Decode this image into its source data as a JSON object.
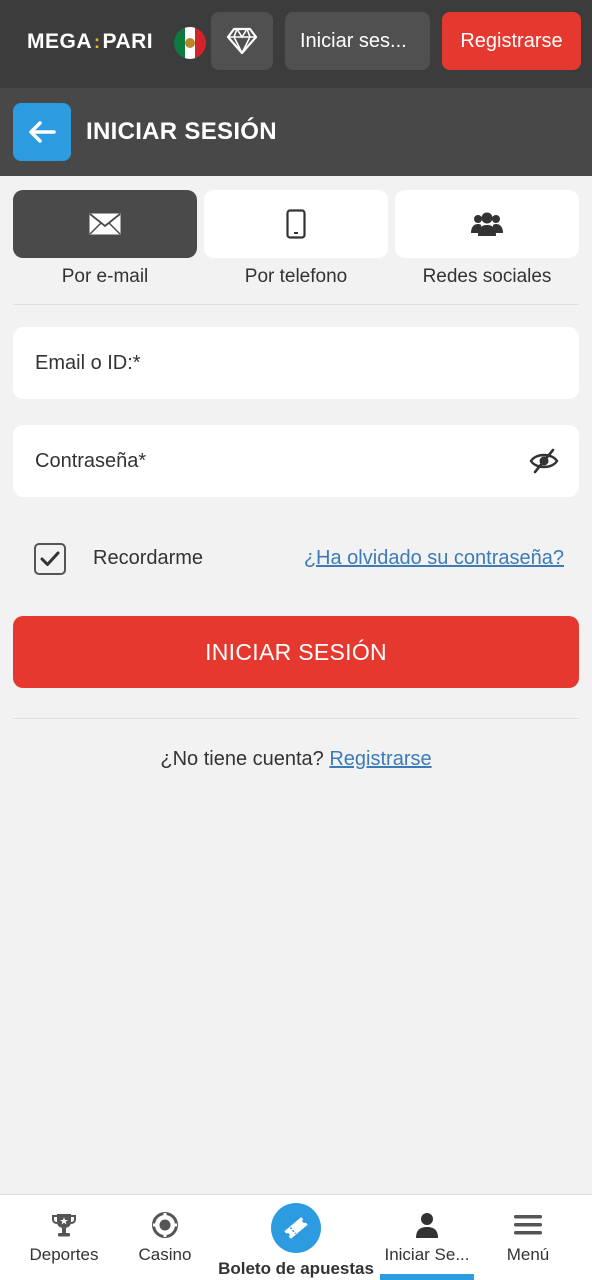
{
  "topbar": {
    "logo_left": "MEGA",
    "logo_sep": ":",
    "logo_right": "PARI",
    "login_label": "Iniciar ses...",
    "register_label": "Registrarse"
  },
  "header": {
    "title": "INICIAR SESIÓN"
  },
  "tabs": [
    {
      "label": "Por e-mail",
      "icon": "envelope-icon",
      "active": true
    },
    {
      "label": "Por telefono",
      "icon": "phone-icon",
      "active": false
    },
    {
      "label": "Redes sociales",
      "icon": "users-icon",
      "active": false
    }
  ],
  "form": {
    "email_placeholder": "Email o ID:*",
    "password_placeholder": "Contraseña*",
    "remember_label": "Recordarme",
    "remember_checked": true,
    "forgot_link": "¿Ha olvidado su contraseña?",
    "submit_label": "INICIAR SESIÓN"
  },
  "signup": {
    "prompt": "¿No tiene cuenta?",
    "link": "Registrarse"
  },
  "bottom_nav": [
    {
      "label": "Deportes",
      "icon": "trophy-icon"
    },
    {
      "label": "Casino",
      "icon": "casino-chip-icon"
    },
    {
      "label": "Boleto de apuestas",
      "icon": "ticket-icon"
    },
    {
      "label": "Iniciar Se...",
      "icon": "user-icon",
      "active": true
    },
    {
      "label": "Menú",
      "icon": "menu-icon"
    }
  ],
  "colors": {
    "topbar": "#3c3c3c",
    "header": "#484848",
    "accent_red": "#e53930",
    "accent_blue": "#2d9be0",
    "link": "#3d7ab8"
  }
}
